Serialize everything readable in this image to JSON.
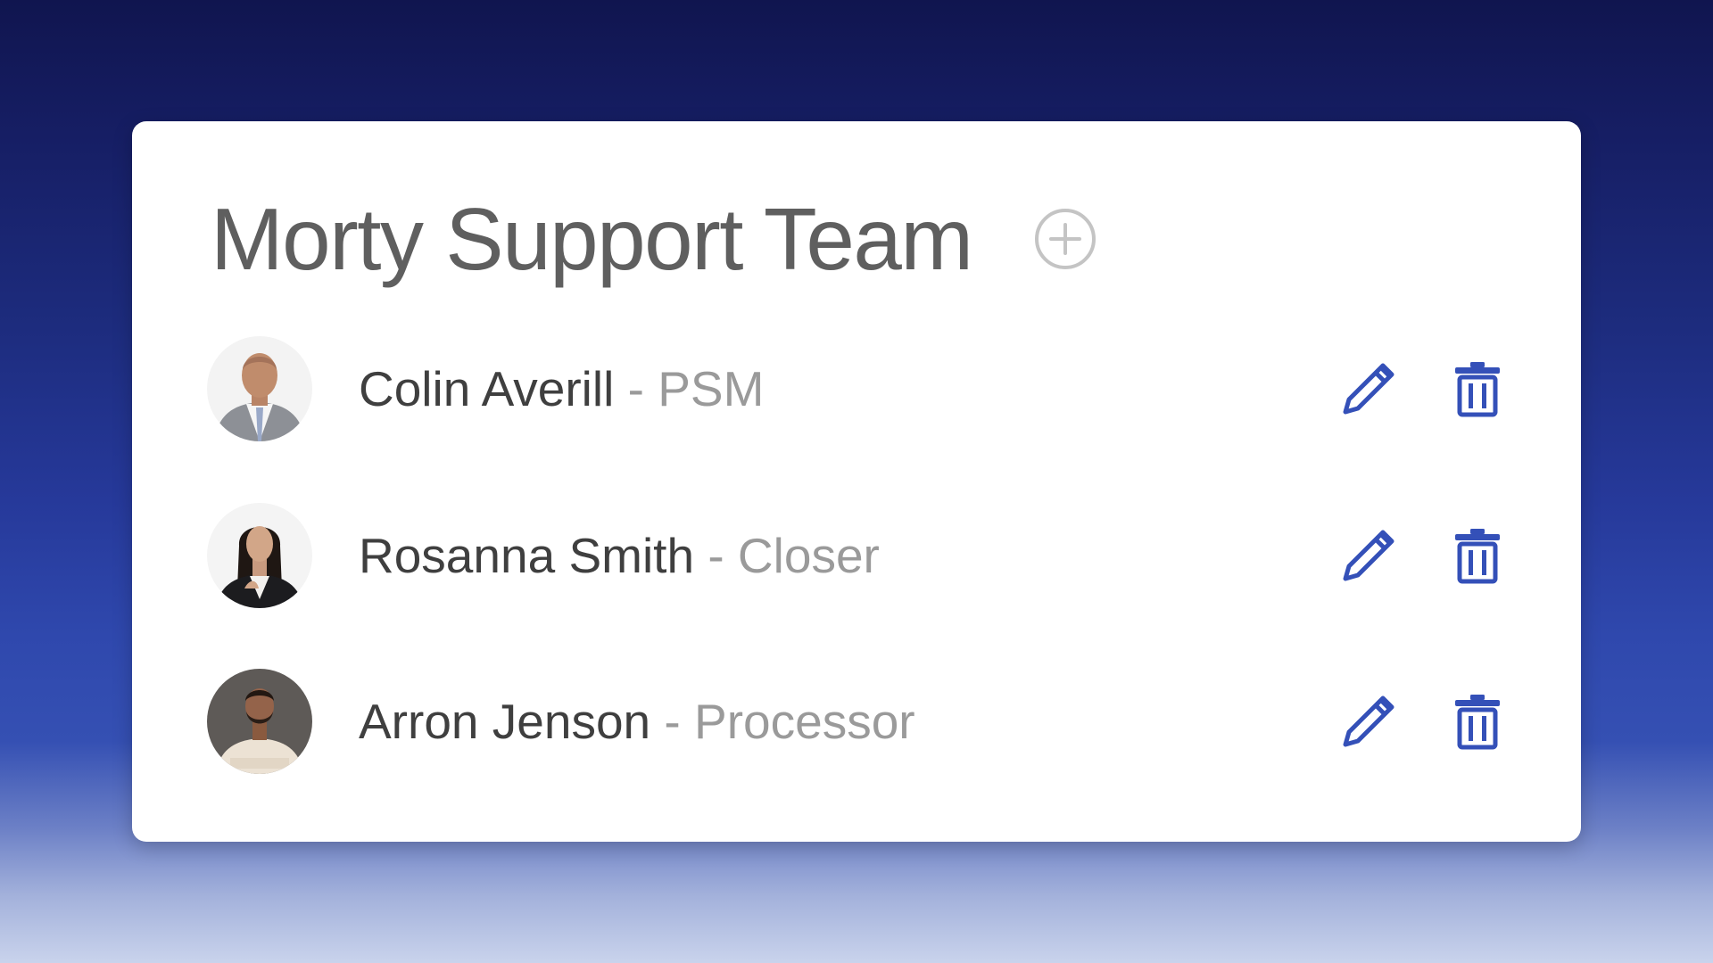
{
  "team": {
    "title": "Morty Support Team",
    "add_icon": "plus-circle-icon"
  },
  "colors": {
    "accent": "#3450b8",
    "title": "#5f5f5f",
    "name": "#3f3f3f",
    "role": "#9a9a9a",
    "add_icon": "#c4c4c4"
  },
  "members": [
    {
      "name": "Colin Averill",
      "separator": "-",
      "role": "PSM",
      "avatar_icon": "avatar-photo",
      "edit_icon": "pencil-icon",
      "delete_icon": "trash-icon"
    },
    {
      "name": "Rosanna Smith",
      "separator": "-",
      "role": "Closer",
      "avatar_icon": "avatar-photo",
      "edit_icon": "pencil-icon",
      "delete_icon": "trash-icon"
    },
    {
      "name": "Arron Jenson",
      "separator": "-",
      "role": "Processor",
      "avatar_icon": "avatar-photo",
      "edit_icon": "pencil-icon",
      "delete_icon": "trash-icon"
    }
  ]
}
